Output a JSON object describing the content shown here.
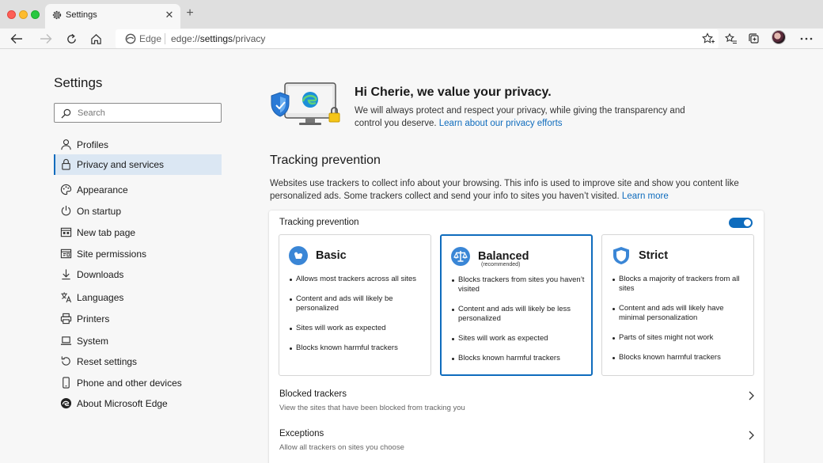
{
  "browser": {
    "tab_title": "Settings",
    "tab_close": "✕",
    "new_tab": "+",
    "address_label": "Edge",
    "address_prefix": "edge://",
    "address_path_bold": "settings",
    "address_suffix": "/privacy"
  },
  "sidebar": {
    "title": "Settings",
    "search_placeholder": "Search",
    "items": [
      {
        "label": "Profiles",
        "icon": "person-icon"
      },
      {
        "label": "Privacy and services",
        "icon": "lock-icon",
        "active": true
      },
      {
        "label": "Appearance",
        "icon": "palette-icon"
      },
      {
        "label": "On startup",
        "icon": "power-icon"
      },
      {
        "label": "New tab page",
        "icon": "new-tab-icon"
      },
      {
        "label": "Site permissions",
        "icon": "site-permissions-icon"
      },
      {
        "label": "Downloads",
        "icon": "download-icon"
      },
      {
        "label": "Languages",
        "icon": "languages-icon"
      },
      {
        "label": "Printers",
        "icon": "printer-icon"
      },
      {
        "label": "System",
        "icon": "laptop-icon"
      },
      {
        "label": "Reset settings",
        "icon": "reset-icon"
      },
      {
        "label": "Phone and other devices",
        "icon": "phone-icon"
      },
      {
        "label": "About Microsoft Edge",
        "icon": "edge-logo-icon"
      }
    ]
  },
  "hero": {
    "title": "Hi Cherie, we value your privacy.",
    "text": "We will always protect and respect your privacy, while giving the transparency and control you deserve.",
    "link": "Learn about our privacy efforts"
  },
  "tracking": {
    "section_title": "Tracking prevention",
    "description": "Websites use trackers to collect info about your browsing. This info is used to improve site  and show you content like personalized ads. Some trackers collect and send your info to sites you haven’t visited.",
    "learn_more": "Learn more",
    "card_title": "Tracking prevention",
    "enabled": true,
    "options": [
      {
        "name": "Basic",
        "subtitle": "",
        "selected": false,
        "bullets": [
          "Allows most trackers across all sites",
          "Content and ads will likely be personalized",
          "Sites will work as expected",
          "Blocks known harmful trackers"
        ]
      },
      {
        "name": "Balanced",
        "subtitle": "(recommended)",
        "selected": true,
        "bullets": [
          "Blocks trackers from sites you haven’t visited",
          "Content and ads will likely be less personalized",
          "Sites will work as expected",
          "Blocks known harmful trackers"
        ]
      },
      {
        "name": "Strict",
        "subtitle": "",
        "selected": false,
        "bullets": [
          "Blocks a majority of trackers from all sites",
          "Content and ads will likely have minimal personalization",
          "Parts of sites might not work",
          "Blocks known harmful trackers"
        ]
      }
    ],
    "blocked": {
      "title": "Blocked trackers",
      "subtitle": "View the sites that have been blocked from tracking you"
    },
    "exceptions": {
      "title": "Exceptions",
      "subtitle": "Allow all trackers on sites you choose"
    }
  },
  "colors": {
    "accent": "#0f6cbd",
    "active_bg": "#dbe7f3"
  }
}
